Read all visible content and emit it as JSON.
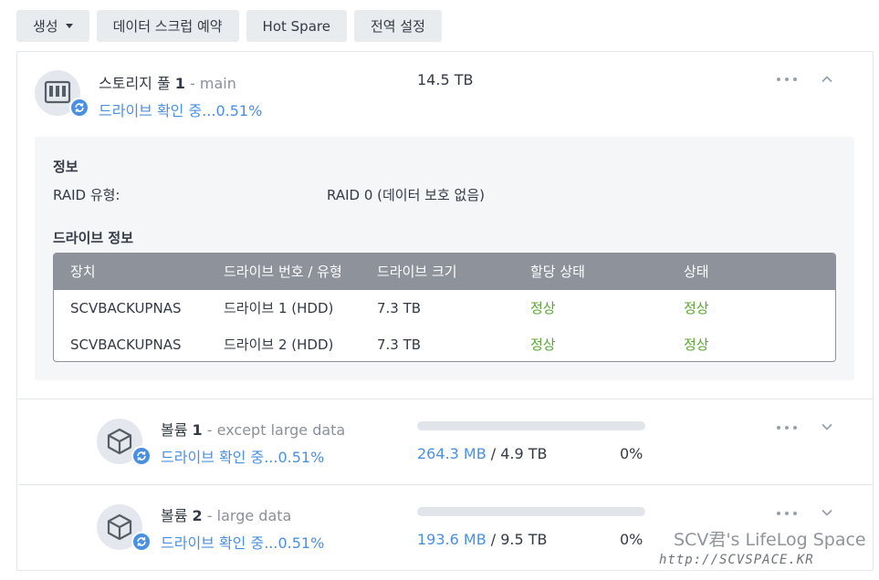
{
  "toolbar": {
    "create_label": "생성",
    "scrub_label": "데이터 스크럽 예약",
    "hotspare_label": "Hot Spare",
    "global_label": "전역 설정"
  },
  "pool": {
    "title": "스토리지 풀",
    "number": "1",
    "separator": "-",
    "name": "main",
    "status": "드라이브 확인 중...0.51%",
    "size": "14.5 TB",
    "info_heading": "정보",
    "raid_label": "RAID 유형:",
    "raid_value": "RAID 0 (데이터 보호 없음)",
    "drive_info_heading": "드라이브 정보",
    "table": {
      "headers": [
        "장치",
        "드라이브 번호 / 유형",
        "드라이브 크기",
        "할당 상태",
        "상태"
      ],
      "rows": [
        [
          "SCVBACKUPNAS",
          "드라이브 1 (HDD)",
          "7.3 TB",
          "정상",
          "정상"
        ],
        [
          "SCVBACKUPNAS",
          "드라이브 2 (HDD)",
          "7.3 TB",
          "정상",
          "정상"
        ]
      ]
    }
  },
  "volumes": [
    {
      "title": "볼륨",
      "number": "1",
      "separator": "-",
      "name": "except large data",
      "status": "드라이브 확인 중...0.51%",
      "used": "264.3 MB",
      "slash": "/",
      "total": "4.9 TB",
      "percent_text": "0%",
      "usage_fraction": 0.0
    },
    {
      "title": "볼륨",
      "number": "2",
      "separator": "-",
      "name": "large data",
      "status": "드라이브 확인 중...0.51%",
      "used": "193.6 MB",
      "slash": "/",
      "total": "9.5 TB",
      "percent_text": "0%",
      "usage_fraction": 0.0
    }
  ],
  "watermark": {
    "line1": "SCV君's LifeLog Space",
    "line2": "http://SCVSPACE.KR"
  },
  "icons": {
    "pool": "nas-disk-icon",
    "volume": "cube-icon",
    "badge": "sync-icon",
    "more": "more-icon",
    "collapse": "chevron-up-icon",
    "expand": "chevron-down-icon"
  },
  "colors": {
    "accent": "#4a90e2",
    "ok": "#5ba534",
    "table_header": "#8e939b"
  }
}
